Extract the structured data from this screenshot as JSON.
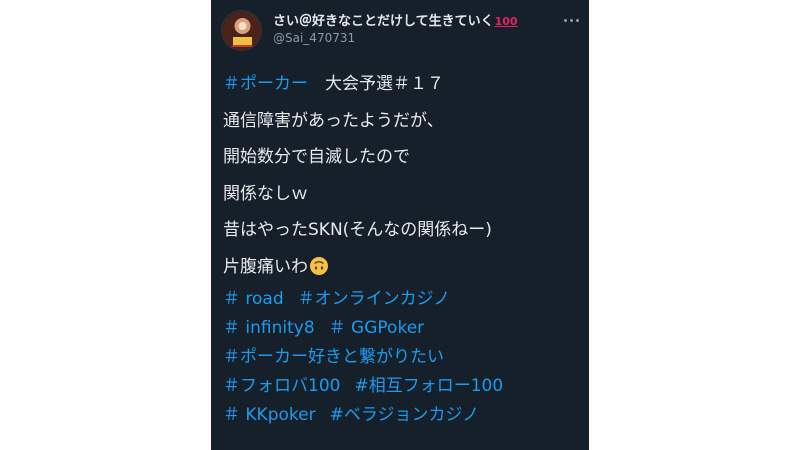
{
  "tweet": {
    "display_name": "さい＠好きなことだけして生きていく",
    "name_emoji": "100",
    "handle": "@Sai_470731",
    "lines": [
      {
        "tag": "＃ポーカー",
        "text": "　大会予選＃１７"
      },
      {
        "text": "通信障害があったようだが、"
      },
      {
        "text": "開始数分で自滅したので"
      },
      {
        "text": "関係なしｗ"
      },
      {
        "text": "昔はやったSKN(そんなの関係ねー)"
      },
      {
        "text": "片腹痛いわ",
        "emoji": "upside-down-face"
      }
    ],
    "hashtag_rows": [
      [
        "＃ road",
        "＃オンラインカジノ"
      ],
      [
        "＃ infinity8",
        "＃ GGPoker"
      ],
      [
        "＃ポーカー好きと繋がりたい"
      ],
      [
        "＃フォロバ100",
        "#相互フォロー100"
      ],
      [
        "＃ KKpoker",
        "#ベラジョンカジノ"
      ]
    ]
  },
  "colors": {
    "background": "#15202b",
    "text": "#e7e9ea",
    "link": "#1d9bf0",
    "muted": "#8b98a5"
  },
  "icons": {
    "more": "more-options-icon",
    "emoji": "upside-down-face-emoji-icon"
  }
}
